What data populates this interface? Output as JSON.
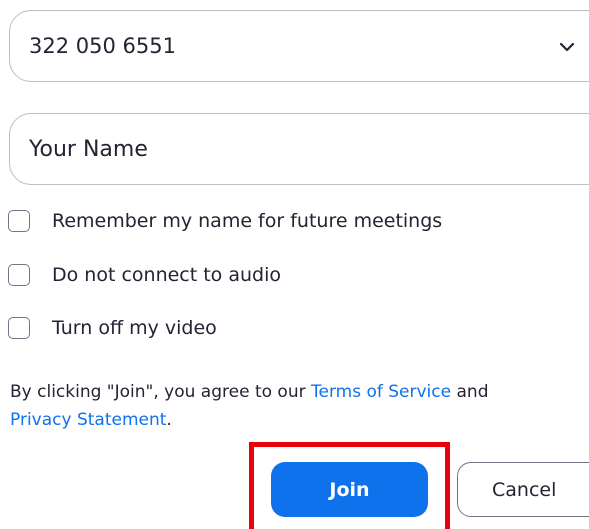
{
  "meeting": {
    "id_value": "322 050 6551",
    "dropdown_icon": "chevron-down-icon"
  },
  "name_field": {
    "placeholder": "Your Name"
  },
  "options": {
    "remember_name": {
      "label": "Remember my name for future meetings",
      "checked": false
    },
    "no_audio": {
      "label": "Do not connect to audio",
      "checked": false
    },
    "video_off": {
      "label": "Turn off my video",
      "checked": false
    }
  },
  "terms": {
    "prefix": "By clicking \"Join\", you agree to our ",
    "tos_link": "Terms of Service",
    "middle": " and ",
    "privacy_link": "Privacy Statement",
    "suffix": "."
  },
  "actions": {
    "join_label": "Join",
    "cancel_label": "Cancel"
  },
  "colors": {
    "accent": "#0e72ed",
    "highlight": "#e8000b",
    "text": "#232333"
  }
}
